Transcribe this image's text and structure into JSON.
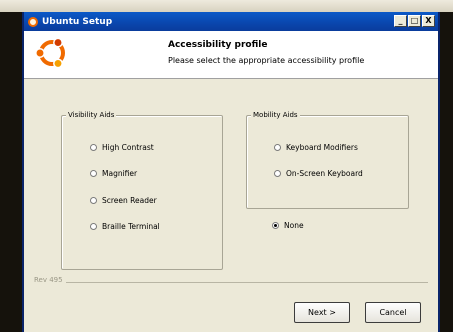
{
  "window": {
    "title": "Ubuntu Setup",
    "minimize": "_",
    "maximize": "□",
    "close": "X"
  },
  "header": {
    "title": "Accessibility profile",
    "subtitle": "Please select the appropriate accessibility profile"
  },
  "visibility": {
    "legend": "Visibility Aids",
    "options": [
      "High Contrast",
      "Magnifier",
      "Screen Reader",
      "Braille Terminal"
    ]
  },
  "mobility": {
    "legend": "Mobility Aids",
    "options": [
      "Keyboard Modifiers",
      "On-Screen Keyboard"
    ]
  },
  "none_option": {
    "label": "None",
    "selected": true
  },
  "footer": {
    "rev": "Rev 495",
    "next_label": "Next >",
    "cancel_label": "Cancel"
  },
  "colors": {
    "titlebar": "#0a46ad",
    "ubuntu_orange": "#f06a00",
    "ubuntu_red": "#d23c00"
  }
}
